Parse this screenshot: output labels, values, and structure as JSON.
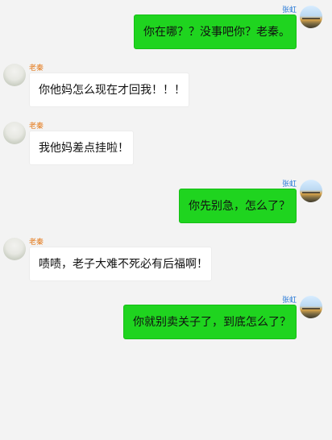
{
  "conversation": {
    "messages": [
      {
        "sender": "张虹",
        "text": "你在哪？？没事吧你？老秦。"
      },
      {
        "sender": "老秦",
        "text": "你他妈怎么现在才回我！！！"
      },
      {
        "sender": "老秦",
        "text": "我他妈差点挂啦！"
      },
      {
        "sender": "张虹",
        "text": "你先别急，怎么了？"
      },
      {
        "sender": "老秦",
        "text": "啧啧，老子大难不死必有后福啊！"
      },
      {
        "sender": "张虹",
        "text": "你就别卖关子了，到底怎么了？"
      }
    ]
  },
  "colors": {
    "background": "#f3f3f3",
    "outgoing_bubble": "#1fd41f",
    "incoming_bubble": "#ffffff",
    "sender_right_name": "#1f74d6",
    "sender_left_name": "#e47a1b"
  }
}
